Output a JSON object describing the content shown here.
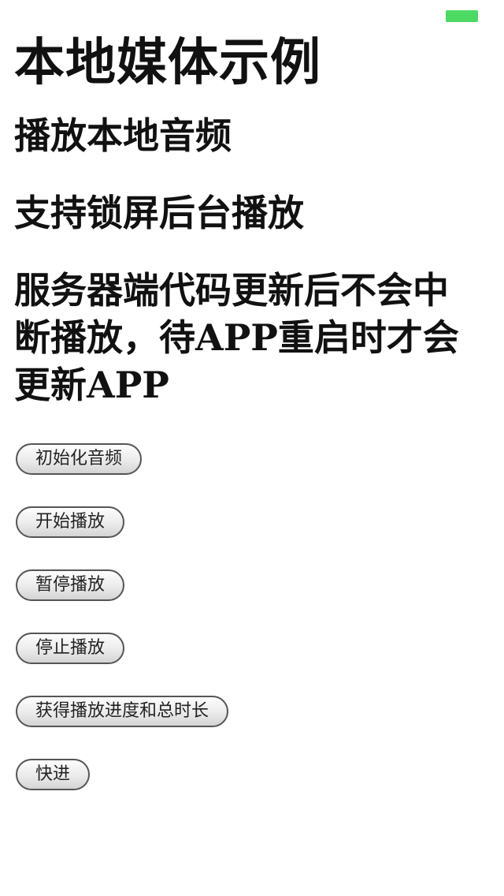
{
  "status_bar": {
    "battery_color": "#4cd964"
  },
  "page": {
    "title": "本地媒体示例",
    "features": [
      "播放本地音频",
      "支持锁屏后台播放",
      "服务器端代码更新后不会中断播放，待APP重启时才会更新APP"
    ]
  },
  "buttons": {
    "init_audio": "初始化音频",
    "start_play": "开始播放",
    "pause_play": "暂停播放",
    "stop_play": "停止播放",
    "get_progress": "获得播放进度和总时长",
    "fast_forward": "快进"
  }
}
